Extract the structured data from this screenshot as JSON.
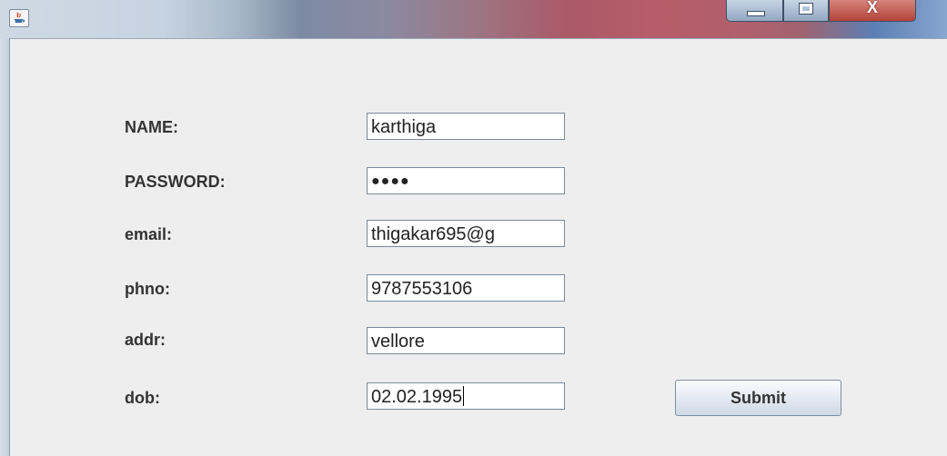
{
  "window": {
    "close_glyph": "X"
  },
  "form": {
    "name_label": "NAME:",
    "name_value": "karthiga",
    "password_label": "PASSWORD:",
    "password_value": "●●●●",
    "email_label": "email:",
    "email_value": "thigakar695@g",
    "phno_label": "phno:",
    "phno_value": "9787553106",
    "addr_label": "addr:",
    "addr_value": "vellore",
    "dob_label": "dob:",
    "dob_value": "02.02.1995",
    "submit_label": "Submit"
  },
  "colors": {
    "background": "#eeeeee",
    "label_text": "#333333",
    "field_border": "#7a8a99",
    "close_button": "#b3443a"
  },
  "icons": {
    "app": "java-app-icon",
    "minimize": "minimize-icon",
    "maximize": "maximize-icon",
    "close": "close-icon"
  }
}
